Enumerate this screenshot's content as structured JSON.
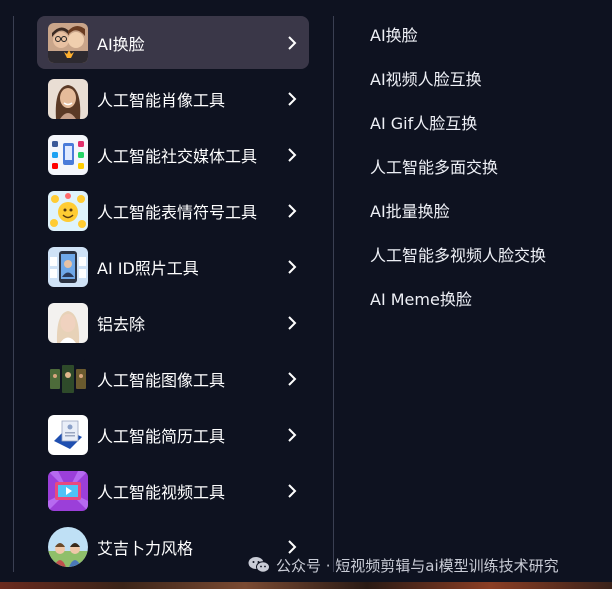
{
  "menu": {
    "items": [
      {
        "label": "AI换脸",
        "icon": "face-swap-thumb",
        "active": true
      },
      {
        "label": "人工智能肖像工具",
        "icon": "portrait-thumb"
      },
      {
        "label": "人工智能社交媒体工具",
        "icon": "social-media-thumb"
      },
      {
        "label": "人工智能表情符号工具",
        "icon": "emoji-thumb"
      },
      {
        "label": "AI ID照片工具",
        "icon": "id-photo-thumb"
      },
      {
        "label": "铝去除",
        "icon": "remove-thumb"
      },
      {
        "label": "人工智能图像工具",
        "icon": "image-tools-thumb"
      },
      {
        "label": "人工智能简历工具",
        "icon": "resume-thumb"
      },
      {
        "label": "人工智能视频工具",
        "icon": "video-tools-thumb"
      },
      {
        "label": "艾吉卜力风格",
        "icon": "ghibli-thumb"
      }
    ]
  },
  "submenu": {
    "items": [
      "AI换脸",
      "AI视频人脸互换",
      "AI Gif人脸互换",
      "人工智能多面交换",
      "AI批量换脸",
      "人工智能多视频人脸交换",
      "AI Meme换脸"
    ]
  },
  "watermark": {
    "text": "公众号 · 短视频剪辑与ai模型训练技术研究",
    "icon": "wechat-icon"
  },
  "colors": {
    "background": "#0e1220",
    "active_item": "#3a3748",
    "divider": "#3a3f52",
    "text": "#ffffff"
  }
}
